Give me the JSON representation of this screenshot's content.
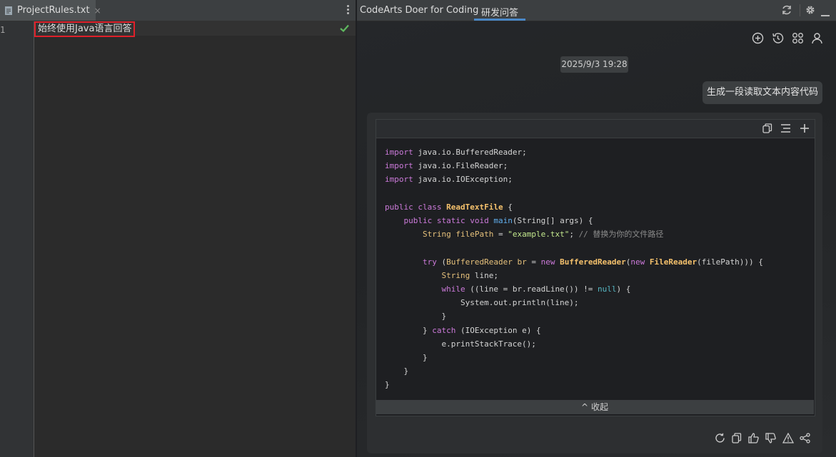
{
  "editor": {
    "tab_label": "ProjectRules.txt",
    "tab_close": "×",
    "line_number": "1",
    "rule_text": "始终使用Java语言回答"
  },
  "assistant": {
    "panel_title": "CodeArts Doer for Coding",
    "active_tab": "研发问答",
    "header_icons": [
      "refresh-icon",
      "settings-icon",
      "minimize-icon"
    ],
    "toolbar_icons": [
      "new-chat-icon",
      "history-icon",
      "apps-icon",
      "user-icon"
    ],
    "timestamp": "2025/9/3 19:28",
    "user_message": "生成一段读取文本内容代码",
    "code_toolbar_icons": [
      "copy-icon",
      "format-icon",
      "insert-icon"
    ],
    "code_lines": [
      "import java.io.BufferedReader;",
      "import java.io.FileReader;",
      "import java.io.IOException;",
      "",
      "public class ReadTextFile {",
      "    public static void main(String[] args) {",
      "        String filePath = \"example.txt\"; // 替换为你的文件路径",
      "",
      "        try (BufferedReader br = new BufferedReader(new FileReader(filePath))) {",
      "            String line;",
      "            while ((line = br.readLine()) != null) {",
      "                System.out.println(line);",
      "            }",
      "        } catch (IOException e) {",
      "            e.printStackTrace();",
      "        }",
      "    }",
      "}"
    ],
    "collapse_label": "收起",
    "collapse_arrow": "^",
    "answer_action_icons": [
      "regenerate-icon",
      "copy-icon",
      "thumbs-up-icon",
      "thumbs-down-icon",
      "report-icon",
      "share-icon"
    ],
    "colors": {
      "accent": "#4a88c7",
      "highlight_border": "#e0202a",
      "check": "#5fb85f"
    }
  }
}
